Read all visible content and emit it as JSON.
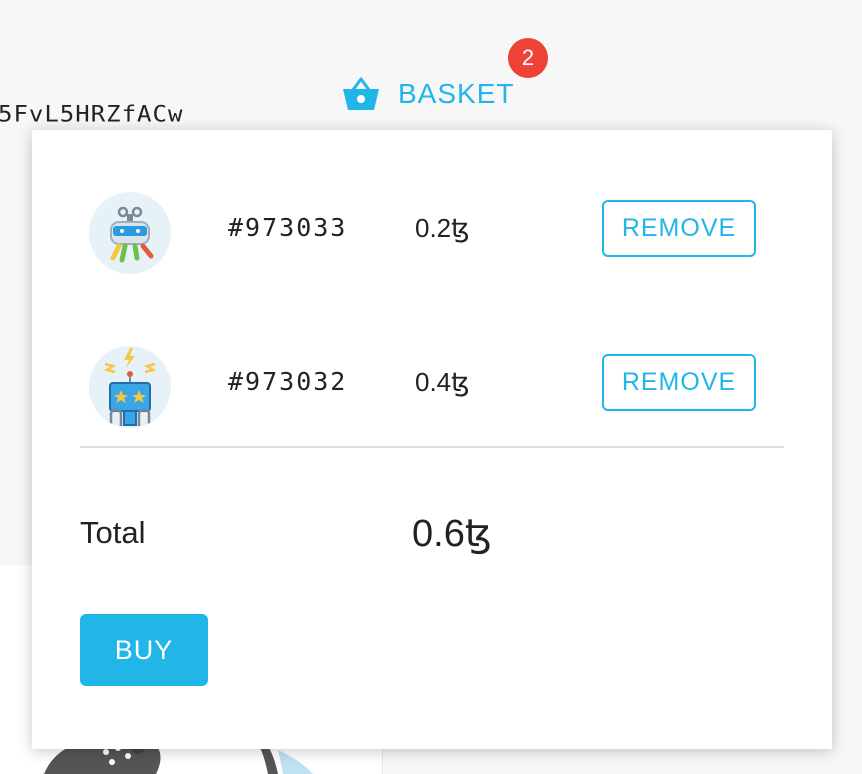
{
  "header": {
    "address_fragment": "5FvL5HRZfACw",
    "basket_label": "BASKET",
    "basket_count": "2",
    "icon": "basket-icon"
  },
  "basket": {
    "items": [
      {
        "id": "#973033",
        "price": "0.2ꜩ",
        "remove_label": "REMOVE",
        "avatar": "robot-avatar"
      },
      {
        "id": "#973032",
        "price": "0.4ꜩ",
        "remove_label": "REMOVE",
        "avatar": "robot-avatar"
      }
    ],
    "total_label": "Total",
    "total_value": "0.6ꜩ",
    "buy_label": "BUY"
  },
  "colors": {
    "accent": "#22b5e8",
    "badge": "#ee4237",
    "text": "#222222"
  }
}
